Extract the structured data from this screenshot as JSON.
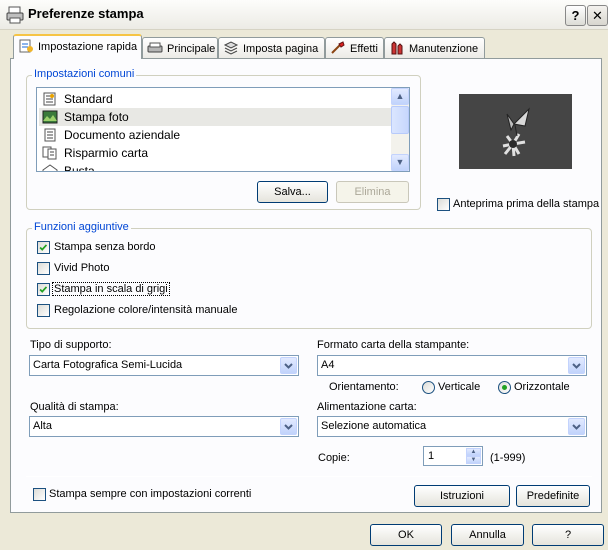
{
  "window": {
    "title": "Preferenze stampa",
    "help_button": "?",
    "close_button": "✕"
  },
  "tabs": [
    {
      "label": "Impostazione rapida"
    },
    {
      "label": "Principale"
    },
    {
      "label": "Imposta pagina"
    },
    {
      "label": "Effetti"
    },
    {
      "label": "Manutenzione"
    }
  ],
  "common": {
    "legend": "Impostazioni comuni",
    "items": [
      "Standard",
      "Stampa foto",
      "Documento aziendale",
      "Risparmio carta",
      "Busta"
    ],
    "selected": "Stampa foto",
    "save": "Salva...",
    "delete": "Elimina"
  },
  "preview_checkbox": "Anteprima prima della stampa",
  "additional": {
    "legend": "Funzioni aggiuntive",
    "options": [
      {
        "label": "Stampa senza bordo",
        "checked": true
      },
      {
        "label": "Vivid Photo",
        "checked": false
      },
      {
        "label": "Stampa in scala di grigi",
        "checked": true
      },
      {
        "label": "Regolazione colore/intensità manuale",
        "checked": false
      }
    ]
  },
  "media": {
    "label": "Tipo di supporto:",
    "value": "Carta Fotografica Semi-Lucida"
  },
  "paper_size": {
    "label": "Formato carta della stampante:",
    "value": "A4"
  },
  "orientation": {
    "label": "Orientamento:",
    "portrait": "Verticale",
    "landscape": "Orizzontale",
    "selected": "Orizzontale"
  },
  "quality": {
    "label": "Qualità di stampa:",
    "value": "Alta"
  },
  "paper_source": {
    "label": "Alimentazione carta:",
    "value": "Selezione automatica"
  },
  "copies": {
    "label": "Copie:",
    "value": "1",
    "range": "(1-999)"
  },
  "always_print": "Stampa sempre con impostazioni correnti",
  "instructions_button": "Istruzioni",
  "defaults_button": "Predefinite",
  "footer": {
    "ok": "OK",
    "cancel": "Annulla",
    "help": "?"
  }
}
